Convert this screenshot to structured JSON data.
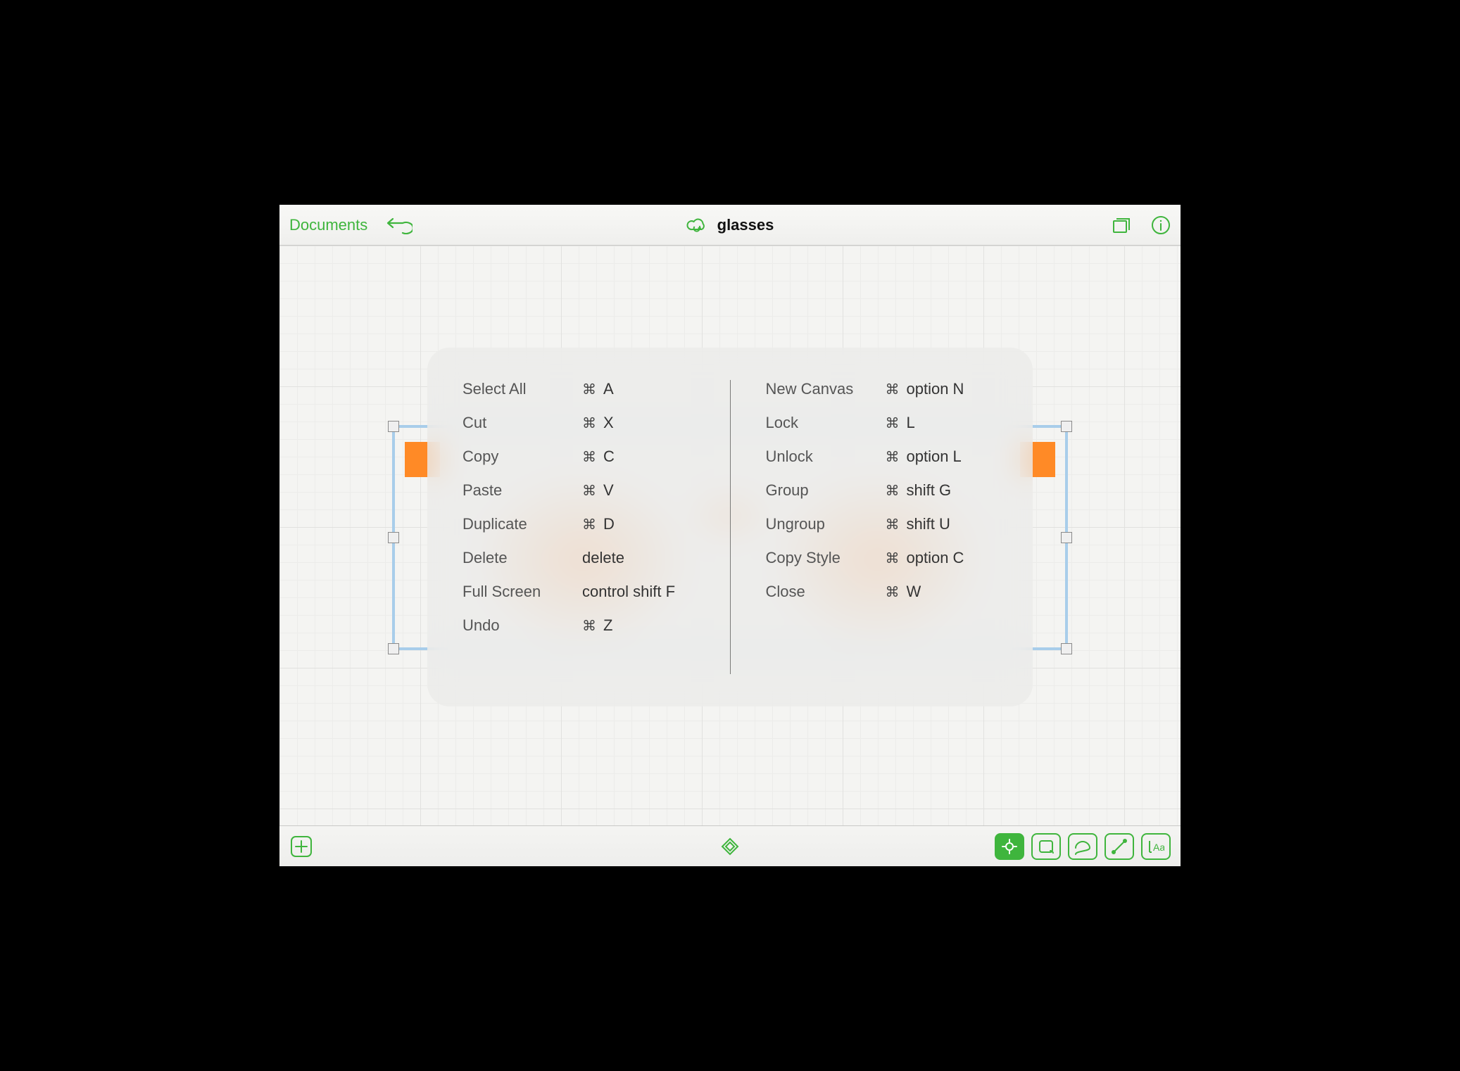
{
  "colors": {
    "accent": "#3fb53d",
    "shape": "#ff8a26",
    "selection": "#a8cdea"
  },
  "topbar": {
    "documents_label": "Documents",
    "title": "glasses"
  },
  "shortcuts": {
    "left": [
      {
        "label": "Select All",
        "cmd": true,
        "keys": "A"
      },
      {
        "label": "Cut",
        "cmd": true,
        "keys": "X"
      },
      {
        "label": "Copy",
        "cmd": true,
        "keys": "C"
      },
      {
        "label": "Paste",
        "cmd": true,
        "keys": "V"
      },
      {
        "label": "Duplicate",
        "cmd": true,
        "keys": "D"
      },
      {
        "label": "Delete",
        "cmd": false,
        "keys": "delete"
      },
      {
        "label": "Full Screen",
        "cmd": false,
        "keys": "control shift F"
      },
      {
        "label": "Undo",
        "cmd": true,
        "keys": "Z"
      }
    ],
    "right": [
      {
        "label": "New Canvas",
        "cmd": true,
        "keys": "option N"
      },
      {
        "label": "Lock",
        "cmd": true,
        "keys": "L"
      },
      {
        "label": "Unlock",
        "cmd": true,
        "keys": "option L"
      },
      {
        "label": "Group",
        "cmd": true,
        "keys": "shift G"
      },
      {
        "label": "Ungroup",
        "cmd": true,
        "keys": "shift U"
      },
      {
        "label": "Copy Style",
        "cmd": true,
        "keys": "option C"
      },
      {
        "label": "Close",
        "cmd": true,
        "keys": "W"
      }
    ]
  },
  "glyphs": {
    "cmd": "⌘"
  },
  "bottombar": {
    "tools": [
      {
        "name": "select-tool",
        "active": true
      },
      {
        "name": "shape-tool",
        "active": false
      },
      {
        "name": "freehand-tool",
        "active": false
      },
      {
        "name": "line-tool",
        "active": false
      },
      {
        "name": "text-tool",
        "active": false
      }
    ]
  }
}
